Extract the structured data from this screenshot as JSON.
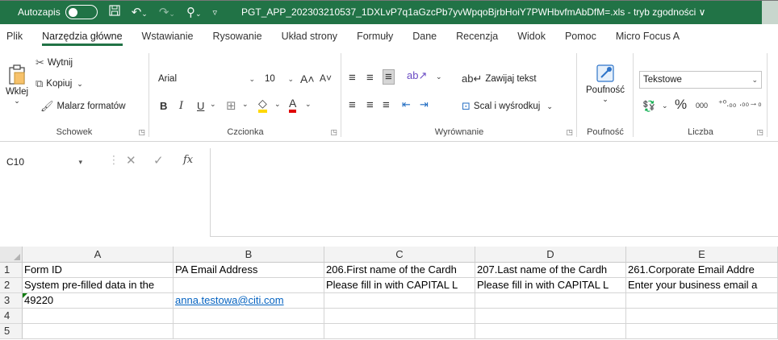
{
  "titlebar": {
    "autosave_label": "Autozapis",
    "filename": "PGT_APP_202303210537_1DXLvP7q1aGzcPb7yvWpqoBjrbHoiY7PWHbvfmAbDfM=.xls  -  tryb zgodności ∨"
  },
  "tabs": [
    "Plik",
    "Narzędzia główne",
    "Wstawianie",
    "Rysowanie",
    "Układ strony",
    "Formuły",
    "Dane",
    "Recenzja",
    "Widok",
    "Pomoc",
    "Micro Focus A"
  ],
  "ribbon": {
    "clipboard": {
      "paste": "Wklej",
      "cut": "Wytnij",
      "copy": "Kopiuj",
      "format_painter": "Malarz formatów",
      "label": "Schowek"
    },
    "font": {
      "name": "Arial",
      "size": "10",
      "label": "Czcionka",
      "bold": "B",
      "italic": "I",
      "underline": "U"
    },
    "alignment": {
      "wrap_text": "Zawijaj tekst",
      "merge_center": "Scal i wyśrodkuj",
      "label": "Wyrównanie"
    },
    "sensitivity": {
      "button": "Poufność",
      "label": "Poufność"
    },
    "number": {
      "format": "Tekstowe",
      "label": "Liczba",
      "percent": "%",
      "thousands": "000"
    }
  },
  "formula_bar": {
    "name_box": "C10",
    "fx": "fx",
    "content": ""
  },
  "grid": {
    "columns": [
      "A",
      "B",
      "C",
      "D",
      "E"
    ],
    "rows": [
      {
        "num": "1",
        "cells": [
          "Form ID",
          "PA Email Address",
          "206.First name of the Cardh",
          "207.Last name of the Cardh",
          "261.Corporate Email Addre"
        ]
      },
      {
        "num": "2",
        "cells": [
          "System pre-filled data in the",
          "",
          "Please fill in with CAPITAL L",
          "Please fill in with CAPITAL L",
          "Enter your business email a"
        ]
      },
      {
        "num": "3",
        "cells": [
          "49220",
          "anna.testowa@citi.com",
          "",
          "",
          ""
        ]
      },
      {
        "num": "4",
        "cells": [
          "",
          "",
          "",
          "",
          ""
        ]
      },
      {
        "num": "5",
        "cells": [
          "",
          "",
          "",
          "",
          ""
        ]
      }
    ]
  },
  "colors": {
    "titlebar_bg": "#217346",
    "accent": "#217346",
    "link": "#0563c1"
  }
}
